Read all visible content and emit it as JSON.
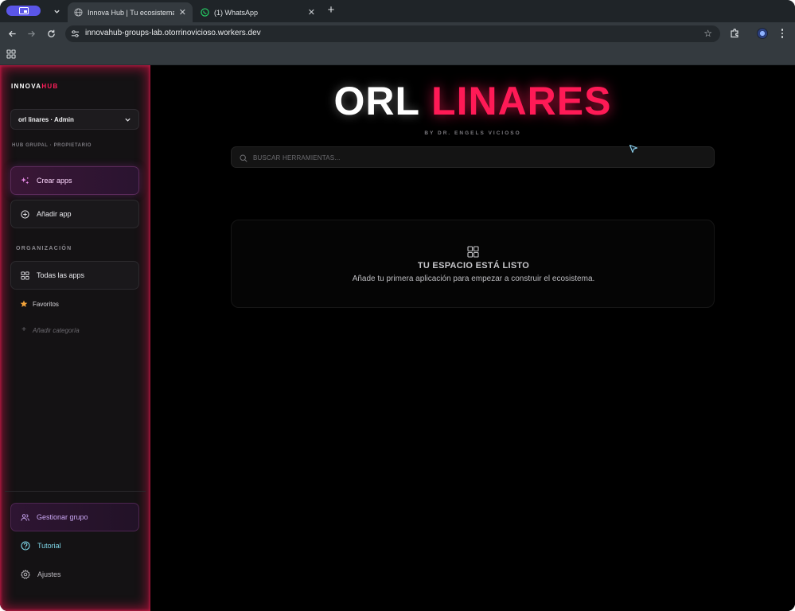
{
  "browser": {
    "tabs": [
      {
        "title": "Innova Hub | Tu ecosistema d",
        "active": true,
        "favicon": "globe-icon"
      },
      {
        "title": "(1) WhatsApp",
        "active": false,
        "favicon": "whatsapp-icon"
      }
    ],
    "url": "innovahub-groups-lab.otorrinovicioso.workers.dev",
    "profile_color": "#5b56e8"
  },
  "sidebar": {
    "brand_part1": "INNOVA",
    "brand_part2": "HUB",
    "group_select": "orl linares · Admin",
    "group_meta": "HUB GRUPAL · PROPIETARIO",
    "create_apps": "Crear apps",
    "add_app": "Añadir app",
    "section_label": "ORGANIZACIÓN",
    "all_apps": "Todas las apps",
    "favorites": "Favoritos",
    "add_category": "Añadir categoría",
    "manage_group": "Gestionar grupo",
    "tutorial": "Tutorial",
    "settings": "Ajustes"
  },
  "main": {
    "title_part1": "ORL",
    "title_part2": "LINARES",
    "byline": "BY DR. ENGELS VICIOSO",
    "search_placeholder": "BUSCAR HERRAMIENTAS...",
    "empty_title": "TU ESPACIO ESTÁ LISTO",
    "empty_desc": "Añade tu primera aplicación para empezar a construir el ecosistema."
  },
  "colors": {
    "accent": "#ff1a56",
    "sidebar_glow": "#e6144b",
    "background": "#000000"
  }
}
